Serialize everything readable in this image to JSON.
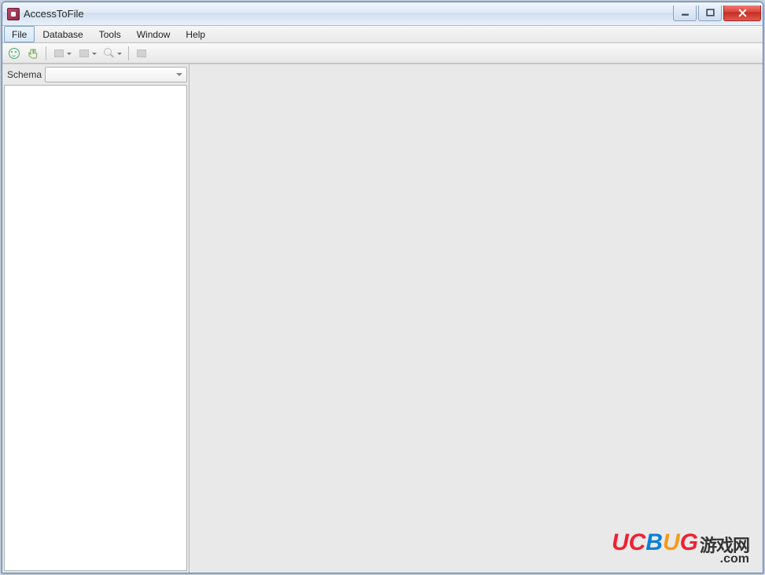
{
  "window": {
    "title": "AccessToFile"
  },
  "menus": {
    "file": "File",
    "database": "Database",
    "tools": "Tools",
    "window": "Window",
    "help": "Help"
  },
  "sidebar": {
    "schema_label": "Schema",
    "schema_value": ""
  },
  "watermark": {
    "brand_u": "U",
    "brand_c": "C",
    "brand_b": "B",
    "brand_u2": "U",
    "brand_g": "G",
    "brand_cn": "游戏网",
    "brand_bottom": ".com"
  }
}
